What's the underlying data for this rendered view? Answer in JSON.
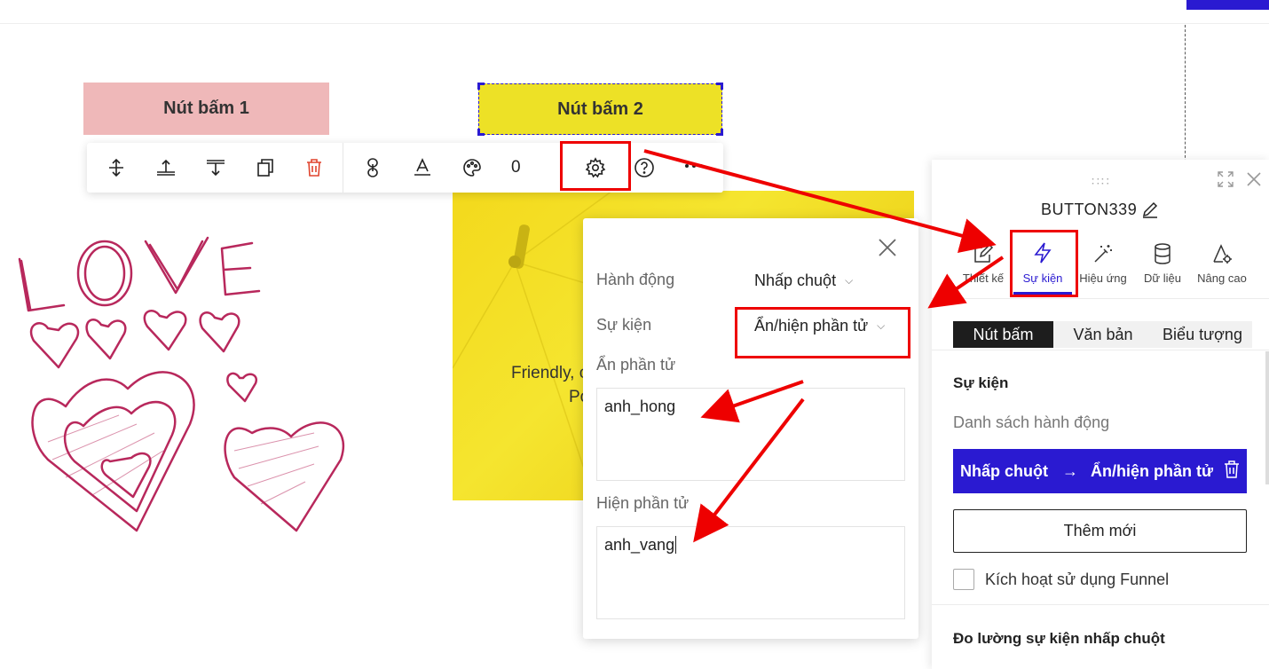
{
  "canvas": {
    "button1_label": "Nút bấm 1",
    "button2_label": "Nút bấm 2",
    "image_text_line1": "Friendly, c",
    "image_text_line2": "Po"
  },
  "toolbar": {
    "icons": [
      "align-top-icon",
      "move-up-icon",
      "move-down-icon",
      "duplicate-icon",
      "trash-icon",
      "link-icon",
      "text-style-icon",
      "palette-icon",
      "settings-gear-icon",
      "help-icon",
      "more-icon"
    ],
    "counter": "0"
  },
  "event_popup": {
    "action_label": "Hành động",
    "action_value": "Nhấp chuột",
    "event_label": "Sự kiện",
    "event_value": "Ẩn/hiện phần tử",
    "hide_label": "Ẩn phần tử",
    "hide_value": "anh_hong",
    "show_label": "Hiện phần tử",
    "show_value": "anh_vang"
  },
  "panel": {
    "title": "BUTTON339",
    "tabs": [
      {
        "label": "Thiết kế",
        "icon": "edit-icon"
      },
      {
        "label": "Sự kiện",
        "icon": "lightning-icon"
      },
      {
        "label": "Hiệu ứng",
        "icon": "magic-wand-icon"
      },
      {
        "label": "Dữ liệu",
        "icon": "database-icon"
      },
      {
        "label": "Nâng cao",
        "icon": "advanced-settings-icon"
      }
    ],
    "active_tab": "Sự kiện",
    "segments": [
      "Nút bấm",
      "Văn bản",
      "Biểu tượng"
    ],
    "section_title": "Sự kiện",
    "action_list_label": "Danh sách hành động",
    "action_trigger": "Nhấp chuột",
    "action_arrow": "→",
    "action_effect": "Ẩn/hiện phần tử",
    "add_new_label": "Thêm mới",
    "funnel_label": "Kích hoạt sử dụng Funnel",
    "measure_title": "Đo lường sự kiện nhấp chuột"
  },
  "colors": {
    "accent": "#2a1ad1",
    "highlight": "#ee0000",
    "button1_bg": "#efb8b9",
    "button2_bg": "#ede126"
  }
}
